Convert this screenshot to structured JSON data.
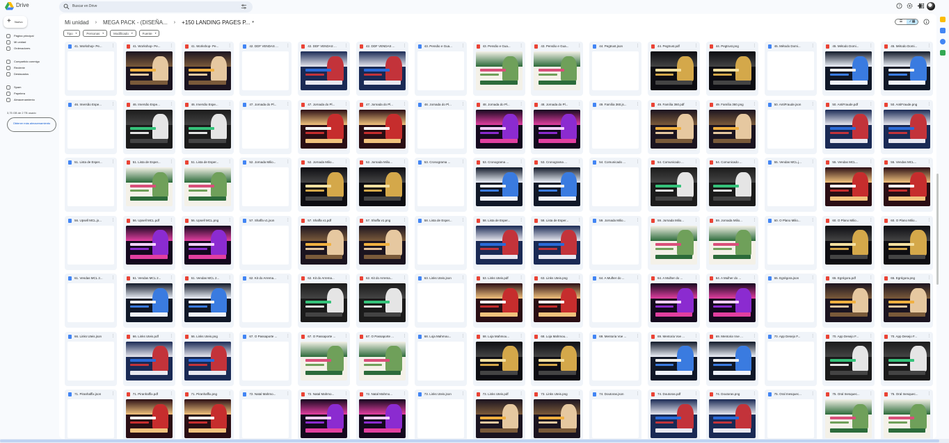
{
  "app": {
    "brand": "Drive"
  },
  "search": {
    "placeholder": "Buscar en Drive"
  },
  "sidebar": {
    "new_label": "Nuevo",
    "items": [
      {
        "label": "Página principal",
        "icon": "home-icon"
      },
      {
        "label": "Mi unidad",
        "icon": "drive-icon"
      },
      {
        "label": "Ordenadores",
        "icon": "computer-icon"
      },
      {
        "label": "Compartido conmigo",
        "icon": "shared-icon"
      },
      {
        "label": "Reciente",
        "icon": "clock-icon"
      },
      {
        "label": "Destacados",
        "icon": "star-icon"
      },
      {
        "label": "Spam",
        "icon": "spam-icon"
      },
      {
        "label": "Papelera",
        "icon": "trash-icon"
      },
      {
        "label": "Almacenamiento",
        "icon": "cloud-icon"
      }
    ],
    "storage_text": "3,75 GB de 2 TB usado",
    "storage_button": "Obtener más almacenamiento"
  },
  "breadcrumb": {
    "root": "Mi unidad",
    "middle": "MEGA PACK - (DISEÑA...",
    "current": "+150 LANDING PAGES P...",
    "sep": "›"
  },
  "filters": [
    "Tipo",
    "Personas",
    "Modificado",
    "Fuente"
  ],
  "view": {
    "list": "☰",
    "grid": "✓▦"
  },
  "colors": {
    "accent": "#0b57d0",
    "selected": "#c2e7ff",
    "json": "#4285f4",
    "pdf": "#ea4335"
  },
  "files": [
    [
      "41. Workshop- Pe...",
      "json"
    ],
    [
      "41. Workshop- Pe...",
      "pdf"
    ],
    [
      "41. Workshop- Pe...",
      "png"
    ],
    [
      "42. DDF VENDAS ...",
      "json"
    ],
    [
      "42. DDF VENDAS ...",
      "pdf"
    ],
    [
      "42. DDF VENDAS ...",
      "png"
    ],
    [
      "43. Pensão e Gua...",
      "json"
    ],
    [
      "43. Pensão e Gua...",
      "pdf"
    ],
    [
      "43. Pensão e Gua...",
      "png"
    ],
    [
      "44. Pegtrust.json",
      "json"
    ],
    [
      "44. Pegtrust.pdf",
      "pdf"
    ],
    [
      "44. Pegtrust.png",
      "png"
    ],
    [
      "45. Método Domi...",
      "json"
    ],
    [
      "45. Método Domi...",
      "pdf"
    ],
    [
      "45. Método Domi...",
      "png"
    ],
    [
      "46. Imersão Espe...",
      "json"
    ],
    [
      "46. Imersão Espe...",
      "pdf"
    ],
    [
      "46. Imersão Espe...",
      "png"
    ],
    [
      "47. Jornada do Pl...",
      "json"
    ],
    [
      "47. Jornada do Pl...",
      "pdf"
    ],
    [
      "47. Jornada do Pl...",
      "png"
    ],
    [
      "48. Jornada do Pl...",
      "json"
    ],
    [
      "48. Jornada do Pl...",
      "pdf"
    ],
    [
      "48. Jornada do Pl...",
      "png"
    ],
    [
      "49. Família 360.js...",
      "json"
    ],
    [
      "49. Família 360.pdf",
      "pdf"
    ],
    [
      "49. Família 360.png",
      "png"
    ],
    [
      "50. AntiFraude.json",
      "json"
    ],
    [
      "50. AntiFraude.pdf",
      "pdf"
    ],
    [
      "50. AntiFraude.png",
      "png"
    ],
    [
      "51. Lista de Esper...",
      "json"
    ],
    [
      "51. Lista de Esper...",
      "pdf"
    ],
    [
      "51. Lista de Esper...",
      "png"
    ],
    [
      "52. Jornada Milio...",
      "json"
    ],
    [
      "52. Jornada Milio...",
      "pdf"
    ],
    [
      "52. Jornada Milio...",
      "png"
    ],
    [
      "53. Cronograma ...",
      "json"
    ],
    [
      "53. Cronograma ...",
      "pdf"
    ],
    [
      "53. Cronograma ...",
      "png"
    ],
    [
      "54. Comunicado ...",
      "json"
    ],
    [
      "54. Comunicado ...",
      "pdf"
    ],
    [
      "54. Comunicado ...",
      "png"
    ],
    [
      "55. Vendas MCL.j...",
      "json"
    ],
    [
      "55. Vendas MCL...",
      "pdf"
    ],
    [
      "55. Vendas MCL...",
      "png"
    ],
    [
      "56. Upsell MCL.js...",
      "json"
    ],
    [
      "56. Upsell MCL.pdf",
      "pdf"
    ],
    [
      "56. Upsell MCL.png",
      "png"
    ],
    [
      "57. Shaffa v1.json",
      "json"
    ],
    [
      "57. Shaffa v1.pdf",
      "pdf"
    ],
    [
      "57. Shaffa v1.png",
      "png"
    ],
    [
      "58. Lista de Esper...",
      "json"
    ],
    [
      "58. Lista de Esper...",
      "pdf"
    ],
    [
      "58. Lista de Esper...",
      "png"
    ],
    [
      "59. Jornada Milio...",
      "json"
    ],
    [
      "59. Jornada Milio...",
      "pdf"
    ],
    [
      "59. Jornada Milio...",
      "png"
    ],
    [
      "60. O Plano Milio...",
      "json"
    ],
    [
      "60. O Plano Milio...",
      "pdf"
    ],
    [
      "60. O Plano Milio...",
      "png"
    ],
    [
      "61. Vendas MCL 2...",
      "json"
    ],
    [
      "61. Vendas MCL 2...",
      "pdf"
    ],
    [
      "61. Vendas MCL 2...",
      "png"
    ],
    [
      "62. Kit do Arrema...",
      "json"
    ],
    [
      "62. Kit do Arrema...",
      "pdf"
    ],
    [
      "62. Kit do Arrema...",
      "png"
    ],
    [
      "63. Links Uteis.json",
      "json"
    ],
    [
      "63. Links Uteis.pdf",
      "pdf"
    ],
    [
      "63. Links Uteis.png",
      "png"
    ],
    [
      "64. A Mulher do ...",
      "json"
    ],
    [
      "64. A Mulher do ...",
      "pdf"
    ],
    [
      "64. A Mulher do ...",
      "png"
    ],
    [
      "65. Egrégora.json",
      "json"
    ],
    [
      "65. Egrégora.pdf",
      "pdf"
    ],
    [
      "65. Egrégora.png",
      "png"
    ],
    [
      "66. Links Uteis.json",
      "json"
    ],
    [
      "66. Links Uteis.pdf",
      "pdf"
    ],
    [
      "66. Links Uteis.png",
      "png"
    ],
    [
      "67. O Passaporte ...",
      "json"
    ],
    [
      "67. O Passaporte ...",
      "pdf"
    ],
    [
      "67. O Passaporte ...",
      "png"
    ],
    [
      "68. Loja Mahmou...",
      "json"
    ],
    [
      "68. Loja Mahmou...",
      "pdf"
    ],
    [
      "68. Loja Mahmou...",
      "png"
    ],
    [
      "69. Mentoria Voe ...",
      "json"
    ],
    [
      "69. Mentoria Voe ...",
      "pdf"
    ],
    [
      "69. Mentoria Voe ...",
      "png"
    ],
    [
      "70. App Desejo F...",
      "json"
    ],
    [
      "70. App Desejo F...",
      "pdf"
    ],
    [
      "70. App Desejo F...",
      "png"
    ],
    [
      "71. Piranhaffix.json",
      "json"
    ],
    [
      "71. Piranhaffix.pdf",
      "pdf"
    ],
    [
      "71. Piranhaffix.png",
      "png"
    ],
    [
      "72. Natal Mahmo...",
      "json"
    ],
    [
      "72. Natal Mahmo...",
      "pdf"
    ],
    [
      "72. Natal Mahmo...",
      "png"
    ],
    [
      "73. Links Uteis.json",
      "json"
    ],
    [
      "73. Links Uteis.pdf",
      "pdf"
    ],
    [
      "73. Links Uteis.png",
      "png"
    ],
    [
      "74. Doutoras.json",
      "json"
    ],
    [
      "74. Doutoras.pdf",
      "pdf"
    ],
    [
      "74. Doutoras.png",
      "png"
    ],
    [
      "75. Oral Inesquec...",
      "json"
    ],
    [
      "75. Oral Inesquec...",
      "pdf"
    ],
    [
      "75. Oral Inesquec...",
      "png"
    ]
  ]
}
